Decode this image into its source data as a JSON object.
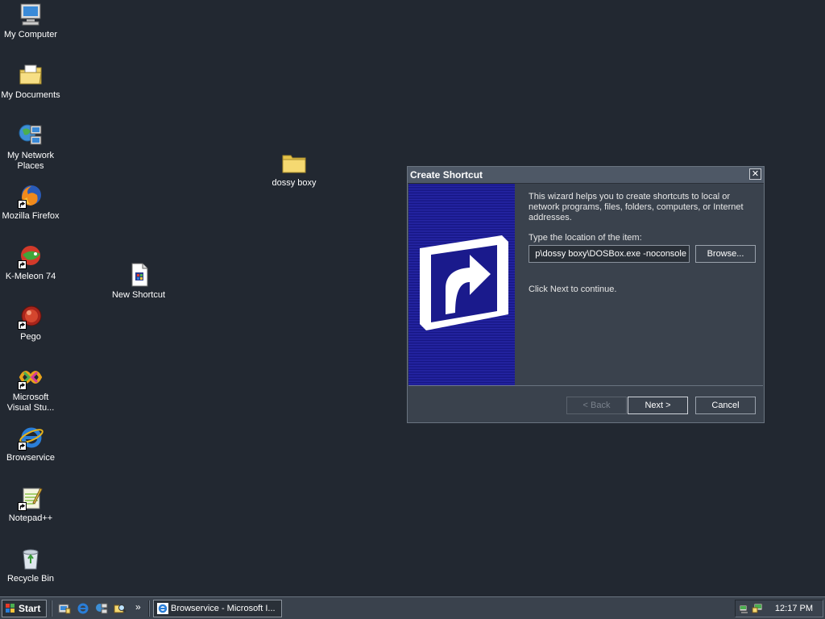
{
  "desktop": {
    "icons": [
      {
        "label_line1": "My Computer",
        "label_line2": ""
      },
      {
        "label_line1": "My Documents",
        "label_line2": ""
      },
      {
        "label_line1": "My Network",
        "label_line2": "Places"
      },
      {
        "label_line1": "Mozilla Firefox",
        "label_line2": ""
      },
      {
        "label_line1": "K-Meleon 74",
        "label_line2": ""
      },
      {
        "label_line1": "Pego",
        "label_line2": ""
      },
      {
        "label_line1": "Microsoft",
        "label_line2": "Visual Stu..."
      },
      {
        "label_line1": "Browservice",
        "label_line2": ""
      },
      {
        "label_line1": "Notepad++",
        "label_line2": ""
      },
      {
        "label_line1": "Recycle Bin",
        "label_line2": ""
      }
    ],
    "free_icons": [
      {
        "label": "New Shortcut"
      },
      {
        "label": "dossy boxy"
      }
    ]
  },
  "dialog": {
    "title": "Create Shortcut",
    "close_glyph": "✕",
    "intro": "This wizard helps you to create shortcuts to local or network programs, files, folders, computers, or Internet addresses.",
    "location_label": "Type the location of the item:",
    "location_value": "p\\dossy boxy\\DOSBox.exe -noconsole",
    "browse_label": "Browse...",
    "continue_text": "Click Next to continue.",
    "back_label": "< Back",
    "next_label": "Next >",
    "cancel_label": "Cancel"
  },
  "taskbar": {
    "start_label": "Start",
    "more_glyph": "»",
    "task_label": "Browservice - Microsoft I...",
    "clock": "12:17 PM"
  },
  "colors": {
    "desktop_bg": "#222831",
    "banner_blue": "#1a1a8c"
  }
}
